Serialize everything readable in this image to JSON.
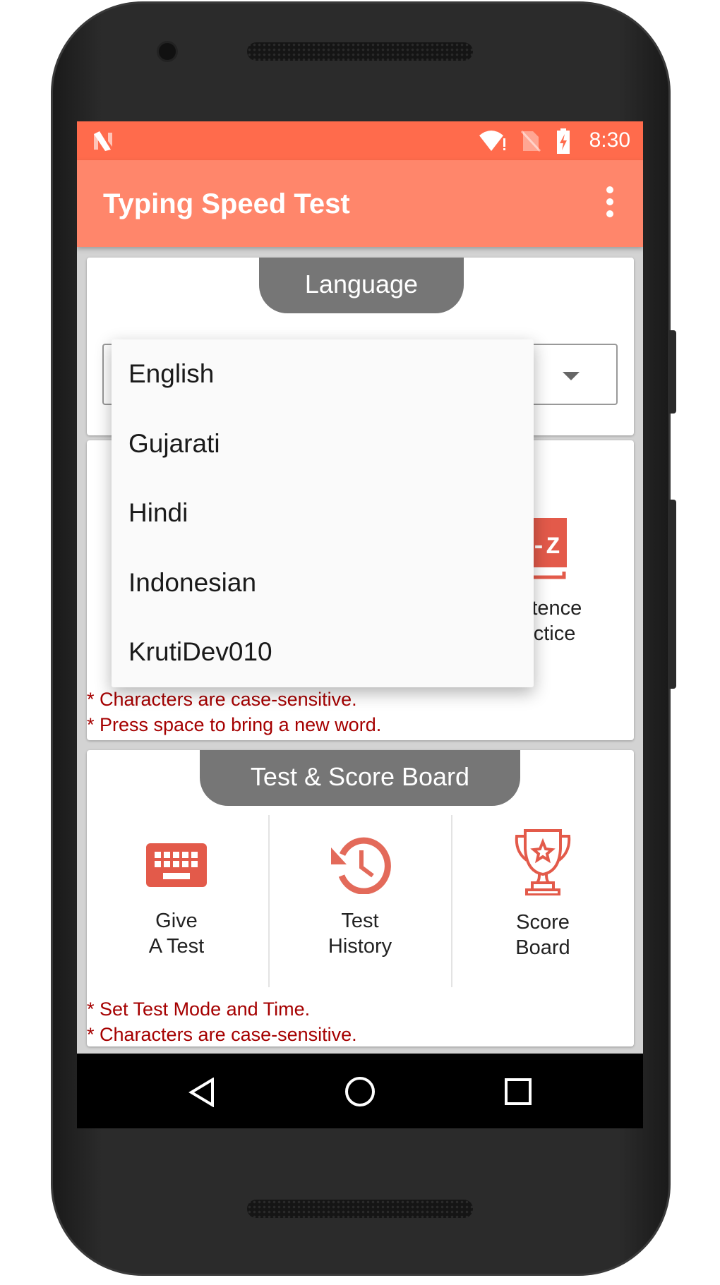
{
  "status_bar": {
    "time": "8:30",
    "icons": [
      "notification-n-icon",
      "wifi-alert-icon",
      "no-sim-icon",
      "battery-charging-icon"
    ]
  },
  "toolbar": {
    "title": "Typing Speed Test",
    "menu_icon": "more-vert-icon"
  },
  "language_card": {
    "tab_label": "Language",
    "selected": "English"
  },
  "dropdown": {
    "options": [
      "English",
      "Gujarati",
      "Hindi",
      "Indonesian",
      "KrutiDev010"
    ]
  },
  "practice_card": {
    "item_label_1": "Sentence",
    "item_label_2": "Practice",
    "notes": [
      "* Characters are case-sensitive.",
      "* Press space to bring a new word."
    ]
  },
  "test_card": {
    "tab_label": "Test & Score Board",
    "items": [
      {
        "line1": "Give",
        "line2": "A Test",
        "icon": "keyboard-icon"
      },
      {
        "line1": "Test",
        "line2": "History",
        "icon": "history-icon"
      },
      {
        "line1": "Score",
        "line2": "Board",
        "icon": "trophy-icon"
      }
    ],
    "notes": [
      "* Set Test Mode and Time.",
      "* Characters are case-sensitive."
    ]
  },
  "colors": {
    "status_bar": "#ff6b4c",
    "toolbar": "#ff866b",
    "icon": "#e35a4a",
    "note": "#a50000",
    "tab": "#767676"
  }
}
